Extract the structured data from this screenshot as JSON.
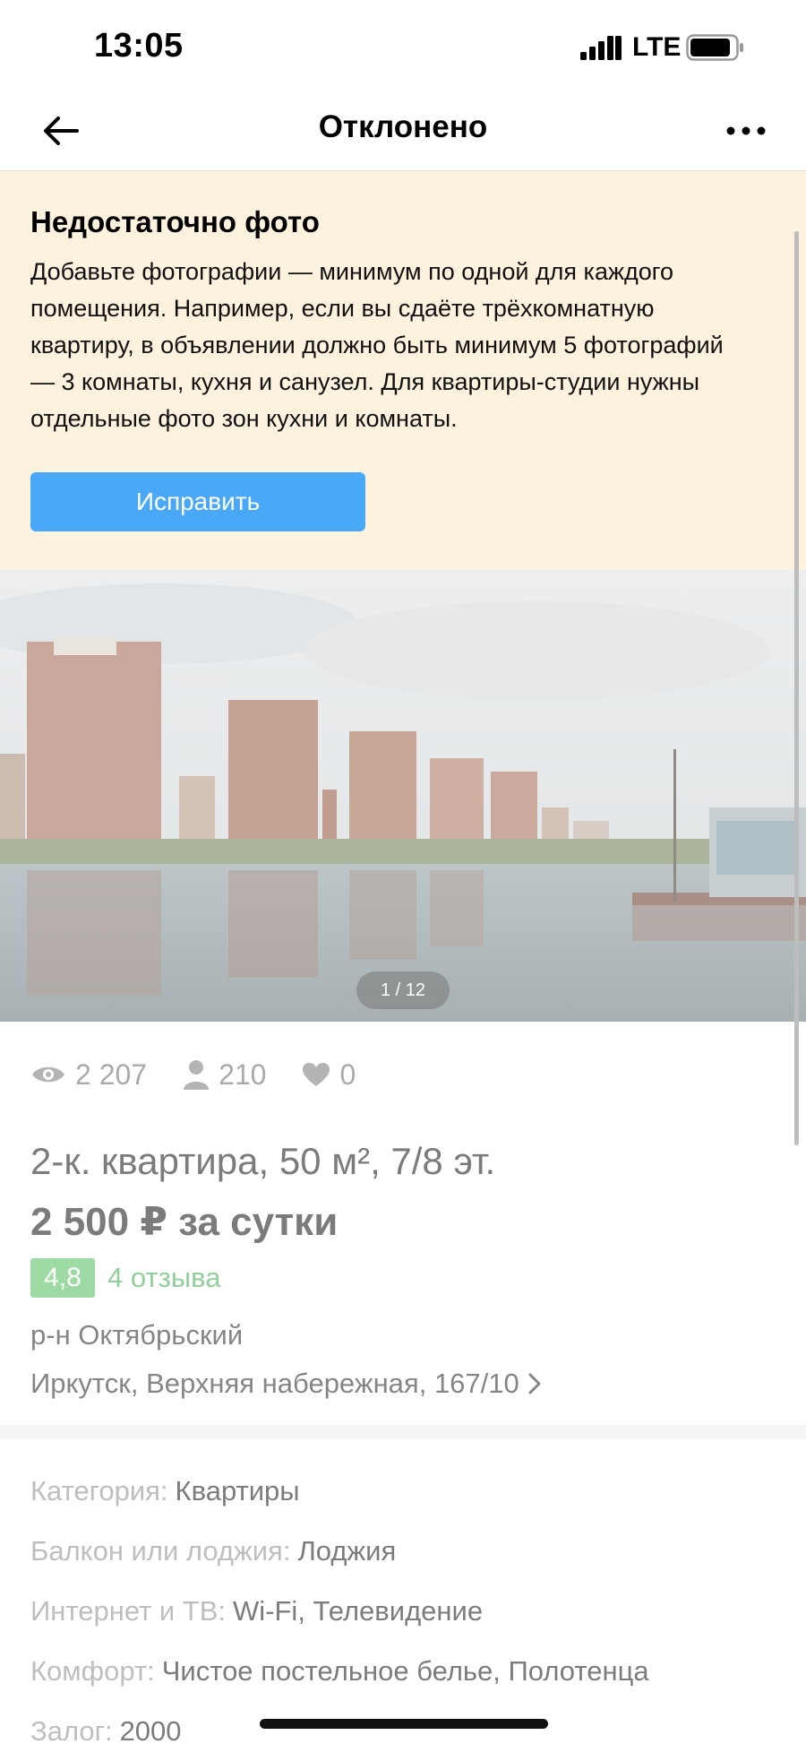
{
  "status_bar": {
    "time": "13:05",
    "network": "LTE",
    "icons": [
      "signal-icon",
      "battery-icon"
    ]
  },
  "nav": {
    "title": "Отклонено",
    "icons": [
      "back-arrow-icon",
      "more-icon"
    ]
  },
  "notice": {
    "title": "Недостаточно фото",
    "text": "Добавьте фотографии — минимум по одной для каждого помещения. Например, если вы сдаёте трёхкомнатную квартиру, в объявлении должно быть минимум 5 фотографий — 3 комнаты, кухня и санузел. Для квартиры-студии нужны отдельные фото зон кухни и комнаты.",
    "button_label": "Исправить",
    "background_color": "#fcf2de",
    "button_color": "#4aa8f8"
  },
  "gallery": {
    "counter": "1 / 12",
    "current": 1,
    "total": 12
  },
  "stats": {
    "views": "2 207",
    "contacts": "210",
    "favorites": "0",
    "icons": [
      "eye-icon",
      "person-icon",
      "heart-icon"
    ]
  },
  "listing": {
    "title": "2-к. квартира, 50 м², 7/8 эт.",
    "price": "2 500 ₽ за сутки",
    "rating": "4,8",
    "reviews": "4 отзыва",
    "district": "р-н Октябрьский",
    "address": "Иркутск, Верхняя набережная, 167/10",
    "rating_color": "#4fbf5a"
  },
  "params": [
    {
      "key": "Категория:",
      "value": "Квартиры"
    },
    {
      "key": "Балкон или лоджия:",
      "value": "Лоджия"
    },
    {
      "key": "Интернет и ТВ:",
      "value": "Wi-Fi, Телевидение"
    },
    {
      "key": "Комфорт:",
      "value": "Чистое постельное белье, Полотенца"
    },
    {
      "key": "Залог:",
      "value": "2000"
    }
  ]
}
